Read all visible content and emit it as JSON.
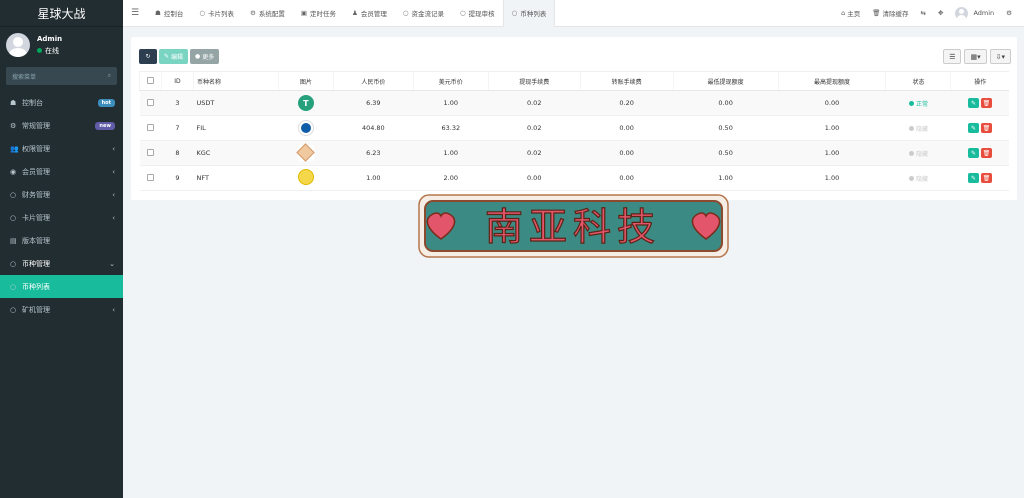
{
  "brand": "星球大战",
  "user": {
    "name": "Admin",
    "status": "在线"
  },
  "sidebar_search": {
    "placeholder": "搜索菜单"
  },
  "menu": [
    {
      "label": "控制台",
      "icon": "dashboard-icon",
      "badge": "hot"
    },
    {
      "label": "常规管理",
      "icon": "cogs-icon",
      "badge": "new"
    },
    {
      "label": "权限管理",
      "icon": "group-icon",
      "chevron": "‹"
    },
    {
      "label": "会员管理",
      "icon": "user-circle-icon",
      "chevron": "‹"
    },
    {
      "label": "财务管理",
      "icon": "circle-icon",
      "chevron": "‹"
    },
    {
      "label": "卡片管理",
      "icon": "circle-icon",
      "chevron": "‹"
    },
    {
      "label": "版本管理",
      "icon": "file-icon"
    },
    {
      "label": "币种管理",
      "icon": "circle-icon",
      "chevron": "⌄"
    },
    {
      "label": "币种列表",
      "icon": "circle-icon"
    },
    {
      "label": "矿机管理",
      "icon": "circle-icon",
      "chevron": "‹"
    }
  ],
  "tabs": [
    {
      "label": "控制台",
      "icon": "dashboard-icon"
    },
    {
      "label": "卡片列表",
      "icon": "circle-icon"
    },
    {
      "label": "系统配置",
      "icon": "gear-icon"
    },
    {
      "label": "定时任务",
      "icon": "task-icon"
    },
    {
      "label": "会员管理",
      "icon": "user-icon"
    },
    {
      "label": "资金流记录",
      "icon": "circle-icon"
    },
    {
      "label": "提现审核",
      "icon": "circle-icon"
    },
    {
      "label": "币种列表",
      "icon": "circle-icon"
    }
  ],
  "nav_right": {
    "home": "主页",
    "clear_cache": "清除缓存",
    "admin": "Admin"
  },
  "toolbar": {
    "edit": "编辑",
    "more": "更多"
  },
  "table": {
    "headers": [
      "ID",
      "币种名称",
      "图片",
      "人民币价",
      "美元币价",
      "提现手续费",
      "转账手续费",
      "最低提现额度",
      "最高提现额度",
      "状态",
      "操作"
    ],
    "rows": [
      {
        "id": "3",
        "name": "USDT",
        "coin": "usdt",
        "cny": "6.39",
        "usd": "1.00",
        "wfee": "0.02",
        "tfee": "0.20",
        "min": "0.00",
        "max": "0.00",
        "status": "正常",
        "on": true
      },
      {
        "id": "7",
        "name": "FIL",
        "coin": "fil",
        "cny": "404.80",
        "usd": "63.32",
        "wfee": "0.02",
        "tfee": "0.00",
        "min": "0.50",
        "max": "1.00",
        "status": "隐藏",
        "on": false
      },
      {
        "id": "8",
        "name": "KGC",
        "coin": "kgc",
        "cny": "6.23",
        "usd": "1.00",
        "wfee": "0.02",
        "tfee": "0.00",
        "min": "0.50",
        "max": "1.00",
        "status": "隐藏",
        "on": false
      },
      {
        "id": "9",
        "name": "NFT",
        "coin": "nft",
        "cny": "1.00",
        "usd": "2.00",
        "wfee": "0.00",
        "tfee": "0.00",
        "min": "1.00",
        "max": "1.00",
        "status": "隐藏",
        "on": false
      }
    ]
  },
  "watermark": "南亚科技",
  "colors": {
    "sidebar": "#222d32",
    "accent": "#18bc9c",
    "danger": "#e74c3c",
    "watermark_bg": "#3b8a84",
    "heart": "#e2556b"
  }
}
